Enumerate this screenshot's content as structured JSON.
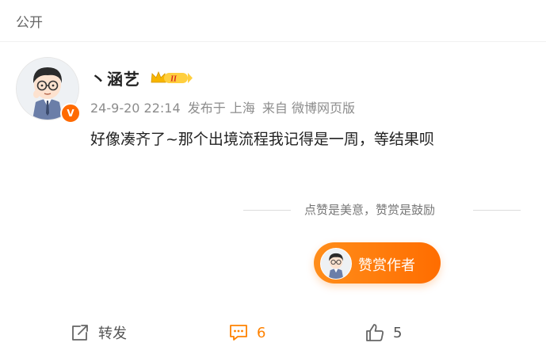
{
  "header": {
    "visibility": "公开"
  },
  "post": {
    "author": "丶涵艺",
    "vip_level": "II",
    "meta": {
      "date": "24-9-20 22:14",
      "published_in": "发布于 上海",
      "source": "来自 微博网页版"
    },
    "content": "好像凑齐了~那个出境流程我记得是一周，等结果呗",
    "verified_badge": "V"
  },
  "reward": {
    "caption": "点赞是美意，赞赏是鼓励",
    "button_label": "赞赏作者"
  },
  "actions": {
    "repost_label": "转发",
    "comment_count": "6",
    "like_count": "5"
  },
  "colors": {
    "accent": "#ff8200",
    "verified": "#ff6a00",
    "vip_gold": "#f7b500"
  },
  "icons": {
    "repost": "share-icon",
    "comment": "comment-icon",
    "like": "thumbs-up-icon"
  }
}
